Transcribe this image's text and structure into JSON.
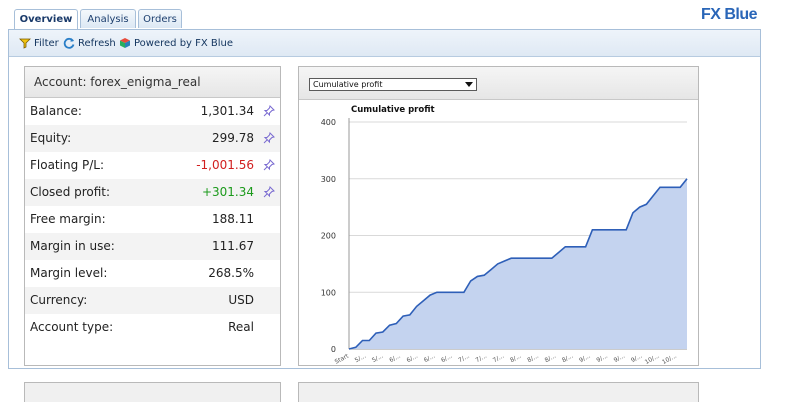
{
  "tabs": [
    "Overview",
    "Analysis",
    "Orders"
  ],
  "brand": "FX Blue",
  "toolbar": {
    "filter": "Filter",
    "refresh": "Refresh",
    "powered": "Powered by FX Blue"
  },
  "account": {
    "title": "Account: forex_enigma_real",
    "rows": [
      {
        "label": "Balance:",
        "value": "1,301.34",
        "pin": true,
        "tone": "normal"
      },
      {
        "label": "Equity:",
        "value": "299.78",
        "pin": true,
        "tone": "normal"
      },
      {
        "label": "Floating P/L:",
        "value": "-1,001.56",
        "pin": true,
        "tone": "neg"
      },
      {
        "label": "Closed profit:",
        "value": "+301.34",
        "pin": true,
        "tone": "pos"
      },
      {
        "label": "Free margin:",
        "value": "188.11",
        "pin": false,
        "tone": "normal"
      },
      {
        "label": "Margin in use:",
        "value": "111.67",
        "pin": false,
        "tone": "normal"
      },
      {
        "label": "Margin level:",
        "value": "268.5%",
        "pin": false,
        "tone": "normal"
      },
      {
        "label": "Currency:",
        "value": "USD",
        "pin": false,
        "tone": "normal"
      },
      {
        "label": "Account type:",
        "value": "Real",
        "pin": false,
        "tone": "normal"
      }
    ]
  },
  "chart_panel": {
    "selected": "Cumulative profit"
  },
  "chart_data": {
    "type": "area",
    "title": "Cumulative profit",
    "ylim": [
      0,
      400
    ],
    "yticks": [
      0,
      100,
      200,
      300,
      400
    ],
    "x_tick_labels": [
      "Start",
      "5/...",
      "5/...",
      "6/...",
      "6/...",
      "6/...",
      "6/...",
      "7/...",
      "7/...",
      "7/...",
      "8/...",
      "8/...",
      "8/...",
      "8/...",
      "9/...",
      "9/...",
      "9/...",
      "9/...",
      "10/...",
      "10/..."
    ],
    "grid": true,
    "fill_color": "#c4d3ef",
    "line_color": "#2e5fb8",
    "series": [
      {
        "values": [
          0,
          3,
          15,
          15,
          28,
          30,
          42,
          45,
          58,
          60,
          75,
          85,
          95,
          100,
          100,
          100,
          100,
          100,
          120,
          128,
          130,
          140,
          150,
          155,
          160,
          160,
          160,
          160,
          160,
          160,
          160,
          170,
          180,
          180,
          180,
          180,
          210,
          210,
          210,
          210,
          210,
          210,
          240,
          250,
          255,
          270,
          285,
          285,
          285,
          285,
          300
        ]
      }
    ]
  }
}
